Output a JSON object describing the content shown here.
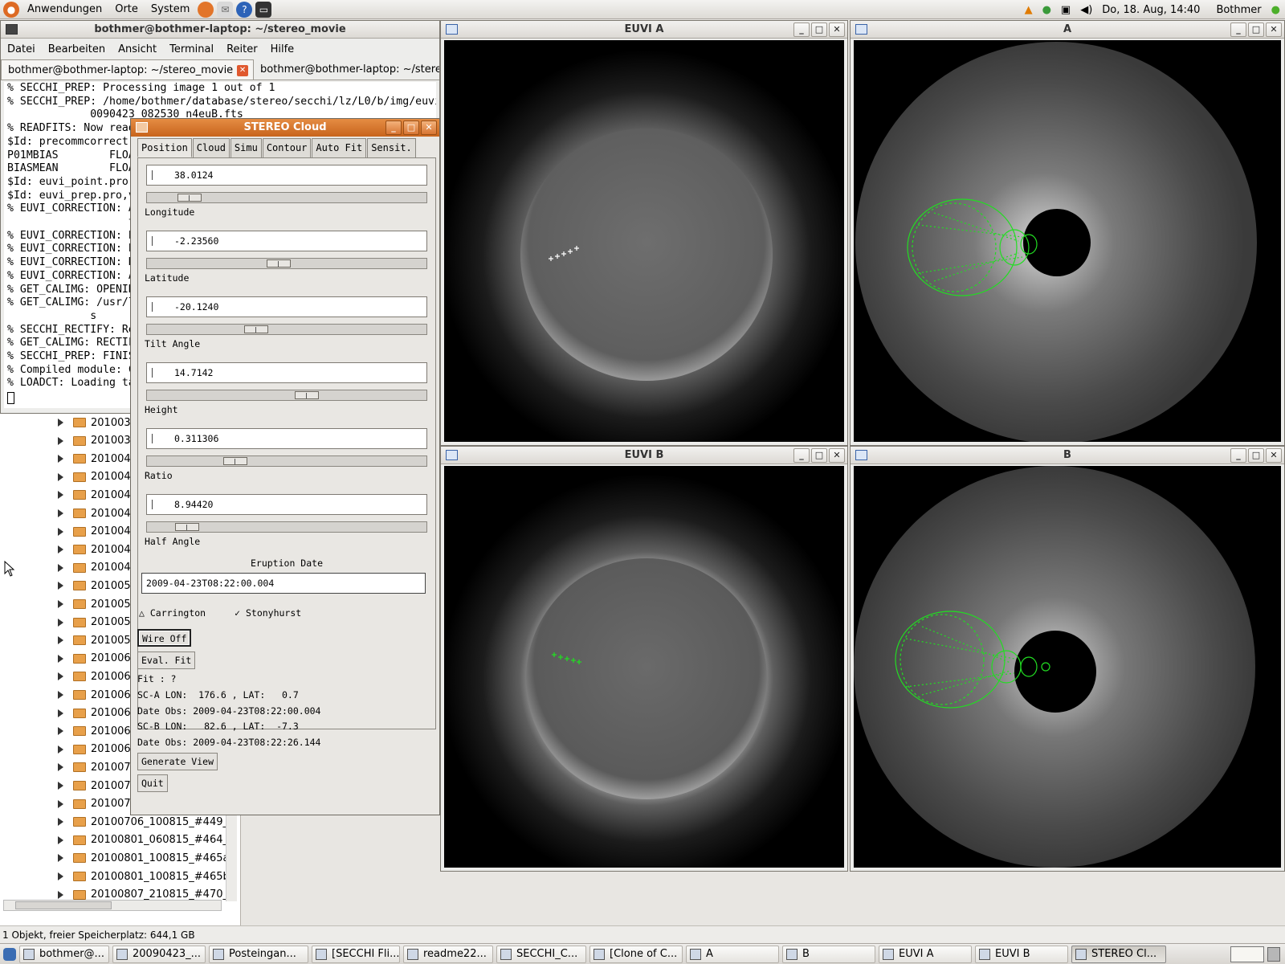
{
  "top_panel": {
    "menus": [
      "Anwendungen",
      "Orte",
      "System"
    ],
    "clock": "Do, 18. Aug, 14:40",
    "user": "Bothmer"
  },
  "terminal": {
    "title": "bothmer@bothmer-laptop: ~/stereo_movie",
    "menus": [
      "Datei",
      "Bearbeiten",
      "Ansicht",
      "Terminal",
      "Reiter",
      "Hilfe"
    ],
    "tabs": [
      "bothmer@bothmer-laptop: ~/stereo_movie",
      "bothmer@bothmer-laptop: ~/stere"
    ],
    "lines": [
      "% SECCHI_PREP: Processing image 1 out of 1",
      "% SECCHI_PREP: /home/bothmer/database/stereo/secchi/lz/L0/b/img/euvi/",
      "             0090423_082530_n4euB.fts",
      "% READFITS: Now read",
      "$Id: precommcorrect.",
      "P01MBIAS        FLOA",
      "BIASMEAN        FLOA",
      "$Id: euvi_point.pro,",
      "$Id: euvi_prep.pro,v",
      "% EUVI_CORRECTION: A",
      "                   t",
      "% EUVI_CORRECTION: E",
      "% EUVI_CORRECTION: E",
      "% EUVI_CORRECTION: N",
      "% EUVI_CORRECTION: A",
      "% GET_CALIMG: OPENIN",
      "% GET_CALIMG: /usr/l",
      "             s",
      "% SECCHI_RECTIFY: Re",
      "% GET_CALIMG: RECTIF",
      "% SECCHI_PREP: FINIS",
      "% Compiled module: C",
      "% LOADCT: Loading ta"
    ]
  },
  "file_tree": {
    "items": [
      "2010032",
      "2010033",
      "2010040",
      "2010040",
      "2010041",
      "2010041",
      "2010041",
      "2010041",
      "2010042",
      "2010050",
      "2010052",
      "2010052",
      "2010052",
      "2010060",
      "2010061",
      "2010061",
      "2010061",
      "2010061",
      "2010062",
      "2010070",
      "2010070",
      "2010070",
      "20100706_100815_#449_",
      "20100801_060815_#464_",
      "20100801_100815_#465a",
      "20100801_100815_#465b",
      "20100807_210815_#470_"
    ],
    "status": "1 Objekt, freier Speicherplatz: 644,1 GB"
  },
  "stereo_cloud": {
    "title": "STEREO Cloud",
    "tabs": [
      "Position",
      "Cloud",
      "Simu",
      "Contour",
      "Auto Fit",
      "Sensit."
    ],
    "params": [
      {
        "label": "Longitude",
        "value": "38.0124",
        "slider": 0.12
      },
      {
        "label": "Latitude",
        "value": "-2.23560",
        "slider": 0.47
      },
      {
        "label": "Tilt Angle",
        "value": "-20.1240",
        "slider": 0.38
      },
      {
        "label": "Height",
        "value": "14.7142",
        "slider": 0.58
      },
      {
        "label": "Ratio",
        "value": "0.311306",
        "slider": 0.3
      },
      {
        "label": "Half Angle",
        "value": "8.94420",
        "slider": 0.11
      }
    ],
    "eruption_date_label": "Eruption Date",
    "eruption_date": "2009-04-23T08:22:00.004",
    "radio_carrington": "Carrington",
    "radio_stonyhurst": "Stonyhurst",
    "wire_button": "Wire Off",
    "eval_button": "Eval. Fit",
    "fit_text": "Fit : ?",
    "sc_a": "SC-A LON:  176.6 , LAT:   0.7",
    "date_obs_a": "Date Obs: 2009-04-23T08:22:00.004",
    "sc_b": "SC-B LON:   82.6 , LAT:  -7.3",
    "date_obs_b": "Date Obs: 2009-04-23T08:22:26.144",
    "generate_button": "Generate View",
    "quit_button": "Quit"
  },
  "image_windows": {
    "euvi_a": "EUVI A",
    "a": "A",
    "euvi_b": "EUVI B",
    "b": "B"
  },
  "taskbar": [
    "bothmer@...",
    "20090423_...",
    "Posteingan...",
    "[SECCHI Fli...",
    "readme22...",
    "SECCHI_C...",
    "[Clone of C...",
    "A",
    "B",
    "EUVI A",
    "EUVI B",
    "STEREO Cl..."
  ],
  "colors": {
    "overlay_wire": "#22dd22",
    "cloud_titlebar": "#d9772e"
  }
}
